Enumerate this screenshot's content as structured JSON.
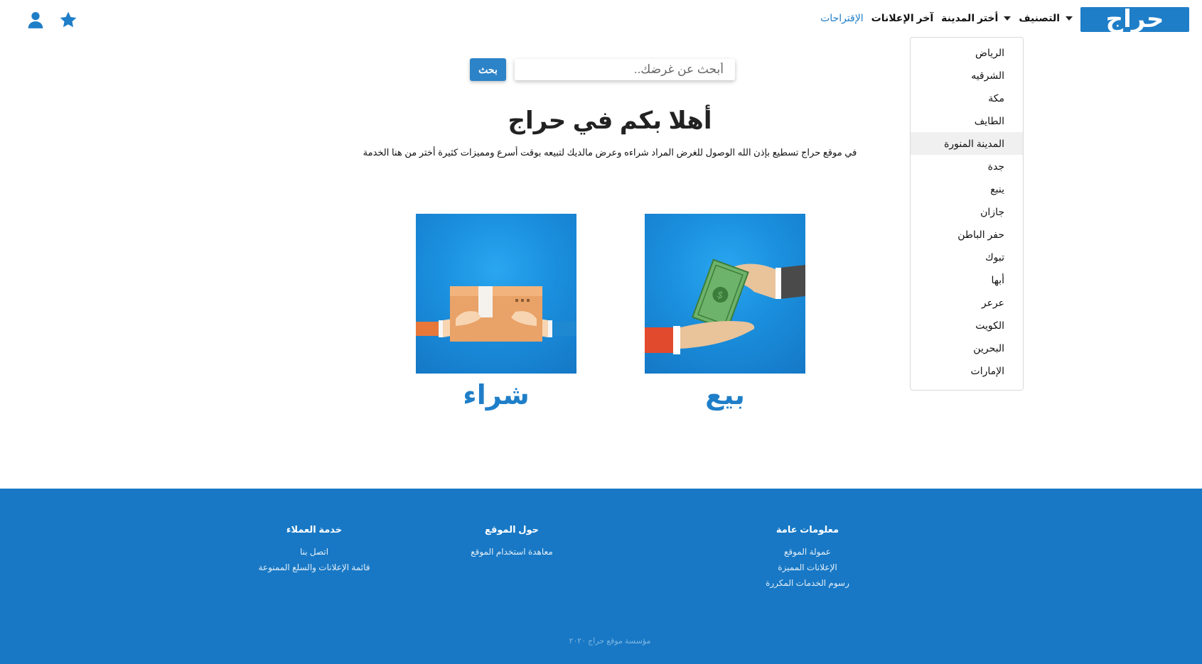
{
  "header": {
    "logo_text": "حراج",
    "nav": [
      {
        "label": "التصنيف",
        "dropdown": true
      },
      {
        "label": "أختر المدينة",
        "dropdown": true
      },
      {
        "label": "آخر الإعلانات",
        "dropdown": false
      },
      {
        "label": "الإقتراحات",
        "dropdown": false
      }
    ],
    "icons": [
      "star-icon",
      "user-icon"
    ]
  },
  "city_dropdown": {
    "items": [
      "الرياض",
      "الشرقيه",
      "مكة",
      "الطايف",
      "المدينة المنورة",
      "جدة",
      "ينبع",
      "جازان",
      "حفر الباطن",
      "تبوك",
      "أبها",
      "عرعر",
      "الكويت",
      "البحرين",
      "الإمارات"
    ],
    "hovered": "المدينة المنورة"
  },
  "search": {
    "placeholder": "أبحث عن غرضك..",
    "button_label": "بحث"
  },
  "hero": {
    "title": "أهلا بكم في حراج",
    "description": "في موقع حراج تسطيع بإذن الله الوصول للغرض المراد شراءه وعرض مالديك لتبيعه بوقت أسرع ومميزات كثيرة أختر من هنا الخدمة"
  },
  "cards": {
    "sell": {
      "label": "بيع",
      "icon": "money-handover-icon"
    },
    "buy": {
      "label": "شراء",
      "icon": "package-handover-icon"
    }
  },
  "footer": {
    "columns": [
      {
        "heading": "معلومات عامة",
        "links": [
          "عمولة الموقع",
          "الإعلانات المميزة",
          "رسوم الخدمات المكررة"
        ]
      },
      {
        "heading": "حول الموقع",
        "links": [
          "معاهدة استخدام الموقع"
        ]
      },
      {
        "heading": "خدمة العملاء",
        "links": [
          "اتصل بنا",
          "قائمة الإعلانات والسلع الممنوعة"
        ]
      }
    ],
    "copyright": "مؤسسة موقع حراج ٢٠٢٠"
  },
  "colors": {
    "brand": "#1f7ec8",
    "footer_bg": "#1878c5",
    "text": "#111111"
  }
}
